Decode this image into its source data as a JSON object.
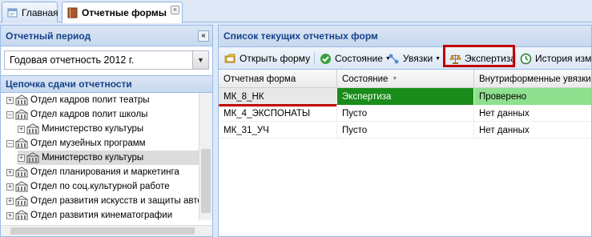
{
  "tabs": [
    {
      "label": "Главная",
      "icon": "home-icon"
    },
    {
      "label": "Отчетные формы",
      "icon": "book-icon",
      "close": "×"
    }
  ],
  "left_panel": {
    "period_title": "Отчетный период",
    "collapse_label": "«",
    "period_value": "Годовая отчетность 2012 г.",
    "chain_title": "Цепочка сдачи отчетности",
    "tree": [
      {
        "label": "Отдел кадров полит театры",
        "expander": "+",
        "level": 0
      },
      {
        "label": "Отдел кадров полит школы",
        "expander": "−",
        "level": 0
      },
      {
        "label": "Министерство культуры",
        "expander": "+",
        "level": 1
      },
      {
        "label": "Отдел музейных программ",
        "expander": "−",
        "level": 0
      },
      {
        "label": "Министерство культуры",
        "expander": "+",
        "level": 1,
        "selected": true
      },
      {
        "label": "Отдел планирования и маркетинга",
        "expander": "+",
        "level": 0
      },
      {
        "label": "Отдел по соц.культурной работе",
        "expander": "+",
        "level": 0
      },
      {
        "label": "Отдел развития искусств и защиты авто",
        "expander": "+",
        "level": 0
      },
      {
        "label": "Отдел развития кинематографии",
        "expander": "+",
        "level": 0
      }
    ]
  },
  "right_panel": {
    "title": "Список текущих отчетных форм",
    "toolbar": {
      "open_form": "Открыть форму",
      "state": "Состояние",
      "links": "Увязки",
      "expertise": "Экспертиза",
      "history": "История изме"
    },
    "columns": [
      "Отчетная форма",
      "Состояние",
      "Внутриформенные увязки"
    ],
    "rows": [
      {
        "form": "МК_8_НК",
        "state": "Экспертиза",
        "links": "Проверено"
      },
      {
        "form": "МК_4_ЭКСПОНАТЫ",
        "state": "Пусто",
        "links": "Нет данных"
      },
      {
        "form": "МК_31_УЧ",
        "state": "Пусто",
        "links": "Нет данных"
      }
    ]
  },
  "colors": {
    "header_text": "#15428b",
    "highlight_red": "#c00000",
    "state_green": "#1a8c1a",
    "verified_green": "#8ee08e"
  }
}
